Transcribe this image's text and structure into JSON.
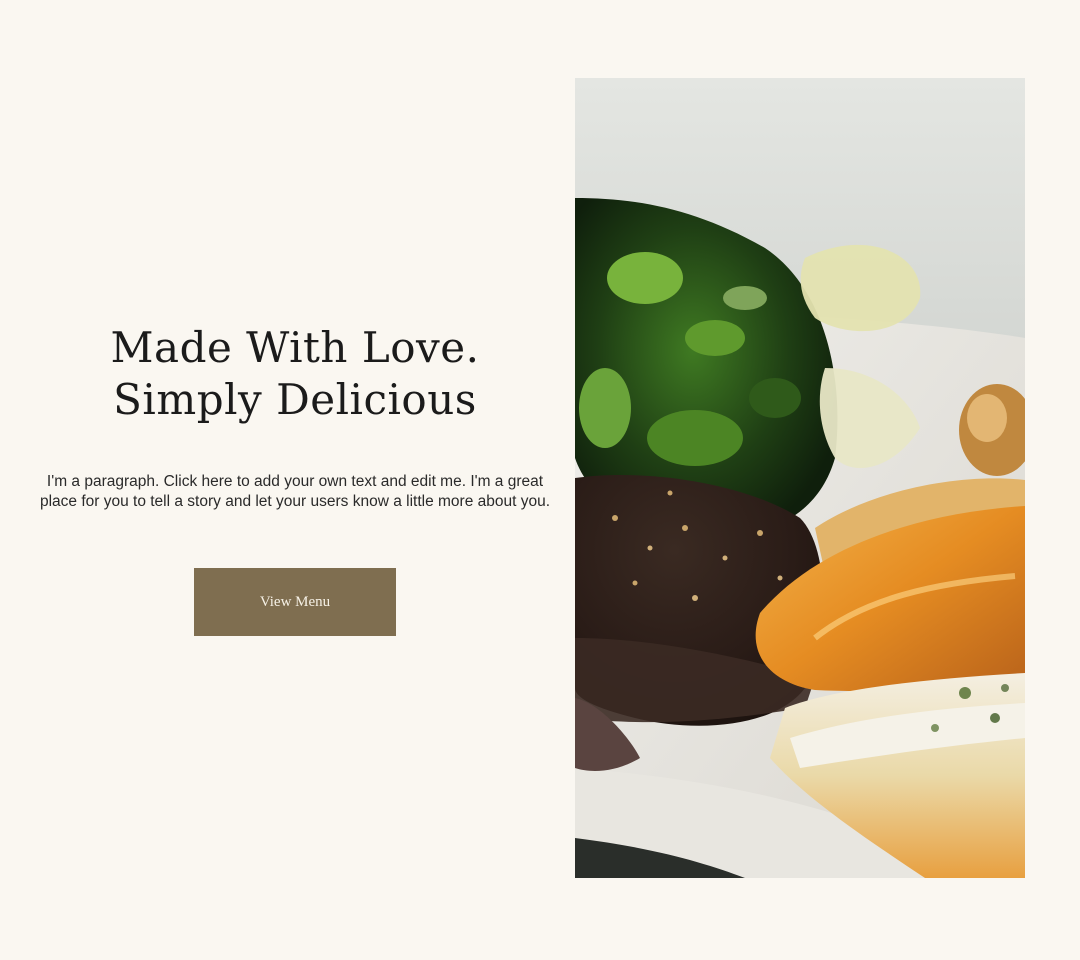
{
  "hero": {
    "headline": "Made With Love. Simply Delicious",
    "paragraph": "I'm a paragraph. Click here to add your own text and edit me. I'm a great place for you to tell a story and let your users know a little more about you.",
    "cta_label": "View Menu"
  },
  "colors": {
    "background": "#faf7f1",
    "button": "#7f6e50",
    "button_text": "#f6f1e6"
  }
}
